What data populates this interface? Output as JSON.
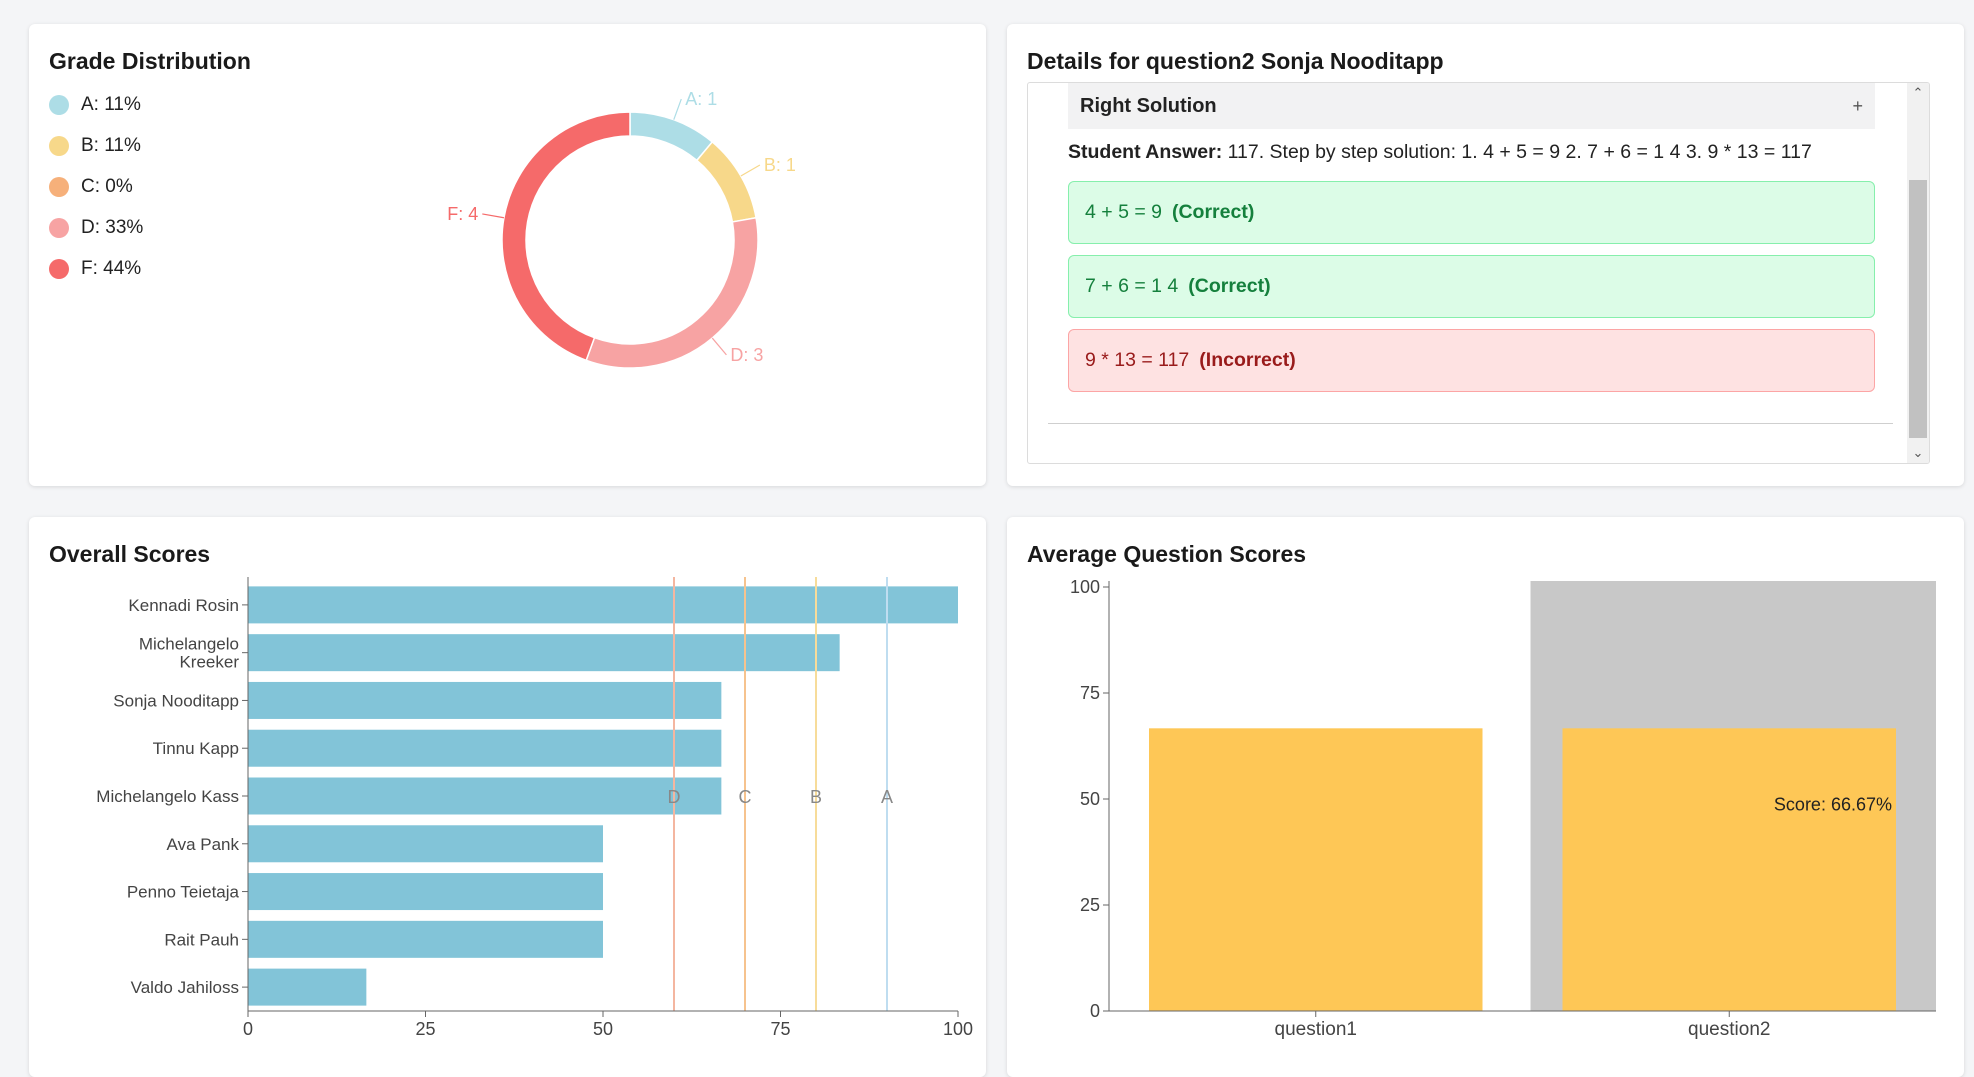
{
  "grade_distribution": {
    "title": "Grade Distribution",
    "legend": [
      {
        "label": "A: 11%",
        "color": "#ADDDE6"
      },
      {
        "label": "B: 11%",
        "color": "#F7D88A"
      },
      {
        "label": "C: 0%",
        "color": "#F6B07A"
      },
      {
        "label": "D: 33%",
        "color": "#F7A3A3"
      },
      {
        "label": "F: 44%",
        "color": "#F56A6A"
      }
    ]
  },
  "details": {
    "title": "Details for question2 Sonja Nooditapp",
    "accordion_label": "Right Solution",
    "accordion_toggle": "+",
    "student_answer_label": "Student Answer:",
    "student_answer_text": "117. Step by step solution: 1. 4 + 5 = 9 2. 7 + 6 = 1 4 3. 9 * 13 = 117",
    "steps": [
      {
        "expr": "4 + 5 = 9",
        "verdict": "(Correct)"
      },
      {
        "expr": "7 + 6 = 1 4",
        "verdict": "(Correct)"
      },
      {
        "expr": "9 * 13 = 117",
        "verdict": "(Incorrect)"
      }
    ]
  },
  "overall": {
    "title": "Overall Scores"
  },
  "average": {
    "title": "Average Question Scores"
  },
  "chart_data": [
    {
      "type": "pie",
      "donut": true,
      "title": "Grade Distribution",
      "slices": [
        {
          "label": "A",
          "value": 1,
          "color": "#ADDDE6",
          "data_label": "A: 1"
        },
        {
          "label": "B",
          "value": 1,
          "color": "#F7D88A",
          "data_label": "B: 1"
        },
        {
          "label": "C",
          "value": 0,
          "color": "#F6B07A",
          "data_label": ""
        },
        {
          "label": "D",
          "value": 3,
          "color": "#F7A3A3",
          "data_label": "D: 3"
        },
        {
          "label": "F",
          "value": 4,
          "color": "#F56A6A",
          "data_label": "F: 4"
        }
      ]
    },
    {
      "type": "bar",
      "orientation": "horizontal",
      "title": "Overall Scores",
      "bar_color": "#82C4D8",
      "categories": [
        "Kennadi Rosin",
        "Michelangelo Kreeker",
        "Sonja Nooditapp",
        "Tinnu Kapp",
        "Michelangelo Kass",
        "Ava Pank",
        "Penno Teietaja",
        "Rait Pauh",
        "Valdo Jahiloss"
      ],
      "values": [
        100,
        83.33,
        66.67,
        66.67,
        66.67,
        50,
        50,
        50,
        16.67
      ],
      "xlim": [
        0,
        100
      ],
      "xticks": [
        0,
        25,
        50,
        75,
        100
      ],
      "thresholds": [
        {
          "label": "D",
          "value": 60,
          "color": "#F4B6A0"
        },
        {
          "label": "C",
          "value": 70,
          "color": "#F6C38E"
        },
        {
          "label": "B",
          "value": 80,
          "color": "#F7DC9A"
        },
        {
          "label": "A",
          "value": 90,
          "color": "#BFDDF0"
        }
      ]
    },
    {
      "type": "bar",
      "title": "Average Question Scores",
      "categories": [
        "question1",
        "question2"
      ],
      "values": [
        66.67,
        66.67
      ],
      "ylim": [
        0,
        100
      ],
      "yticks": [
        0,
        25,
        50,
        75,
        100
      ],
      "bar_color": "#FEC756",
      "highlight_category": "question2",
      "highlight_color": "#C8C8C8",
      "tooltip": "Score: 66.67%"
    }
  ]
}
